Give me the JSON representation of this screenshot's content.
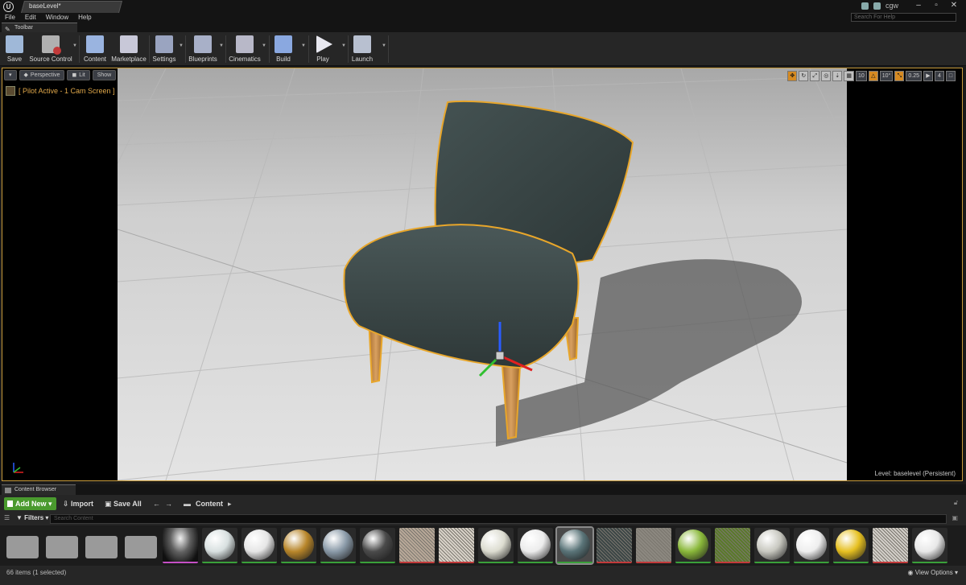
{
  "window": {
    "tab_title": "baseLevel*",
    "user": "cgw",
    "help_placeholder": "Search For Help"
  },
  "menu": [
    "File",
    "Edit",
    "Window",
    "Help"
  ],
  "toolbar": {
    "tab_label": "Toolbar",
    "buttons": [
      {
        "label": "Save",
        "icon": "save-icon",
        "color": "#9fb8d8"
      },
      {
        "label": "Source Control",
        "icon": "source-control-icon",
        "color": "#b0b0b0"
      },
      {
        "label": "Content",
        "icon": "content-icon",
        "color": "#9ab4e0"
      },
      {
        "label": "Marketplace",
        "icon": "marketplace-icon",
        "color": "#c8c8d8"
      },
      {
        "label": "Settings",
        "icon": "settings-icon",
        "color": "#9aa4c0"
      },
      {
        "label": "Blueprints",
        "icon": "blueprints-icon",
        "color": "#a8b0c8"
      },
      {
        "label": "Cinematics",
        "icon": "cinematics-icon",
        "color": "#b8b8c8"
      },
      {
        "label": "Build",
        "icon": "build-icon",
        "color": "#8aa8e0"
      },
      {
        "label": "Play",
        "icon": "play-icon",
        "color": "#e8e8f0"
      },
      {
        "label": "Launch",
        "icon": "launch-icon",
        "color": "#b8c0d0"
      }
    ]
  },
  "viewport": {
    "menu_glyph": "▾",
    "perspective": "Perspective",
    "lit": "Lit",
    "show": "Show",
    "pilot": "[ Pilot Active - 1 Cam Screen ]",
    "grid_snap": "10",
    "rotation_snap": "10°",
    "scale_snap": "0.25",
    "camera_speed": "4",
    "level": "Level:  baselevel (Persistent)"
  },
  "content_browser": {
    "tab_label": "Content Browser",
    "add_new": "Add New",
    "import": "Import",
    "save_all": "Save All",
    "path": "Content",
    "filters": "Filters",
    "search_placeholder": "Search Content",
    "item_count": "66 items (1 selected)",
    "view_options": "View Options",
    "assets": [
      {
        "type": "folder",
        "color": "#9a9a9a"
      },
      {
        "type": "folder",
        "color": "#9a9a9a"
      },
      {
        "type": "folder",
        "color": "#9a9a9a"
      },
      {
        "type": "folder",
        "color": "#9a9a9a"
      },
      {
        "type": "texture",
        "color": "#202020",
        "bar": "#c64fc6"
      },
      {
        "type": "sphere",
        "color": "#d8e0e0",
        "bar": "#3aa03a"
      },
      {
        "type": "sphere",
        "color": "#e6e6e6",
        "bar": "#3aa03a"
      },
      {
        "type": "sphere",
        "color": "#b8862a",
        "bar": "#3aa03a"
      },
      {
        "type": "sphere",
        "color": "#8a9aa8",
        "bar": "#3aa03a"
      },
      {
        "type": "sphere",
        "color": "#4a4a4a",
        "bar": "#3aa03a"
      },
      {
        "type": "flat",
        "color": "#b8a898",
        "bar": "#c23a3a"
      },
      {
        "type": "flat",
        "color": "#d8d2c8",
        "bar": "#c23a3a"
      },
      {
        "type": "sphere",
        "color": "#dcdcd0",
        "bar": "#3aa03a"
      },
      {
        "type": "sphere",
        "color": "#ececec",
        "bar": "#3aa03a"
      },
      {
        "type": "sphere",
        "color": "#5a7478",
        "bar": "#3aa03a",
        "selected": true
      },
      {
        "type": "flat",
        "color": "#3c4646",
        "bar": "#c23a3a"
      },
      {
        "type": "flat",
        "color": "#8c8880",
        "bar": "#c23a3a"
      },
      {
        "type": "sphere",
        "color": "#8ab83a",
        "bar": "#3aa03a"
      },
      {
        "type": "flat",
        "color": "#5a7a2a",
        "bar": "#c23a3a"
      },
      {
        "type": "sphere",
        "color": "#c8c8c0",
        "bar": "#3aa03a"
      },
      {
        "type": "sphere",
        "color": "#eeeeee",
        "bar": "#3aa03a"
      },
      {
        "type": "sphere",
        "color": "#e6c020",
        "bar": "#3aa03a"
      },
      {
        "type": "flat",
        "color": "#d2cec8",
        "bar": "#c23a3a"
      },
      {
        "type": "sphere",
        "color": "#e8e8e8",
        "bar": "#3aa03a"
      }
    ]
  },
  "colors": {
    "accent_orange": "#d58a22",
    "add_new_green": "#4a9a2e",
    "chair_fabric": "#3a4646",
    "chair_leg": "#c8924a",
    "selection_outline": "#e8a62a"
  }
}
